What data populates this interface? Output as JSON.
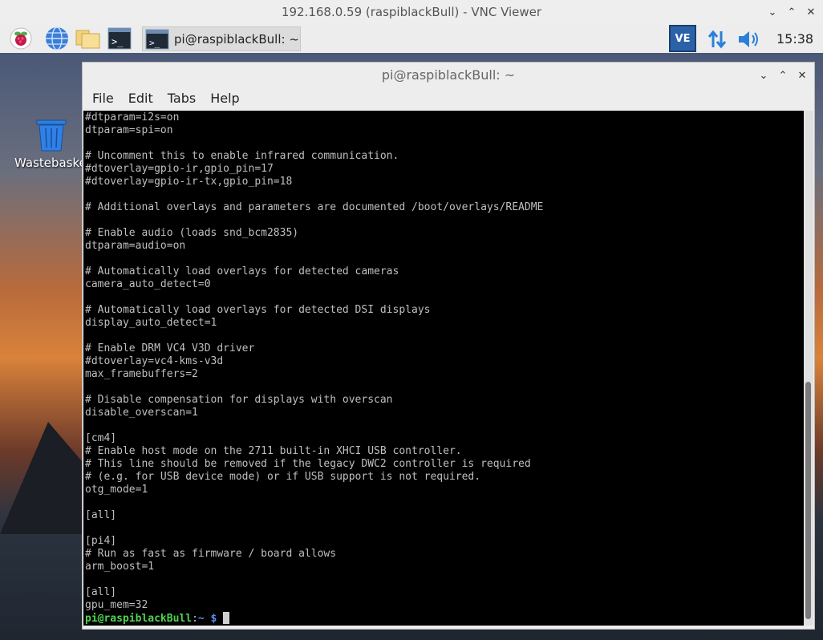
{
  "vnc": {
    "title": "192.168.0.59 (raspiblackBull) - VNC Viewer"
  },
  "panel": {
    "task_label": "pi@raspiblackBull: ~",
    "tray_vnc_label": "VE",
    "clock": "15:38"
  },
  "desktop": {
    "trash_label": "Wastebasket"
  },
  "terminal": {
    "title": "pi@raspiblackBull: ~",
    "menu": [
      "File",
      "Edit",
      "Tabs",
      "Help"
    ],
    "lines": [
      "#dtparam=i2s=on",
      "dtparam=spi=on",
      "",
      "# Uncomment this to enable infrared communication.",
      "#dtoverlay=gpio-ir,gpio_pin=17",
      "#dtoverlay=gpio-ir-tx,gpio_pin=18",
      "",
      "# Additional overlays and parameters are documented /boot/overlays/README",
      "",
      "# Enable audio (loads snd_bcm2835)",
      "dtparam=audio=on",
      "",
      "# Automatically load overlays for detected cameras",
      "camera_auto_detect=0",
      "",
      "# Automatically load overlays for detected DSI displays",
      "display_auto_detect=1",
      "",
      "# Enable DRM VC4 V3D driver",
      "#dtoverlay=vc4-kms-v3d",
      "max_framebuffers=2",
      "",
      "# Disable compensation for displays with overscan",
      "disable_overscan=1",
      "",
      "[cm4]",
      "# Enable host mode on the 2711 built-in XHCI USB controller.",
      "# This line should be removed if the legacy DWC2 controller is required",
      "# (e.g. for USB device mode) or if USB support is not required.",
      "otg_mode=1",
      "",
      "[all]",
      "",
      "[pi4]",
      "# Run as fast as firmware / board allows",
      "arm_boost=1",
      "",
      "[all]",
      "gpu_mem=32"
    ],
    "prompt": {
      "user_host": "pi@raspiblackBull",
      "colon": ":",
      "path": "~",
      "symbol": " $ "
    }
  },
  "colors": {
    "terminal_bg": "#000000",
    "terminal_fg": "#bfbfbf",
    "prompt_user": "#4fd44f",
    "prompt_path": "#5b8cf0",
    "vnc_tray": "#2b62a7"
  }
}
